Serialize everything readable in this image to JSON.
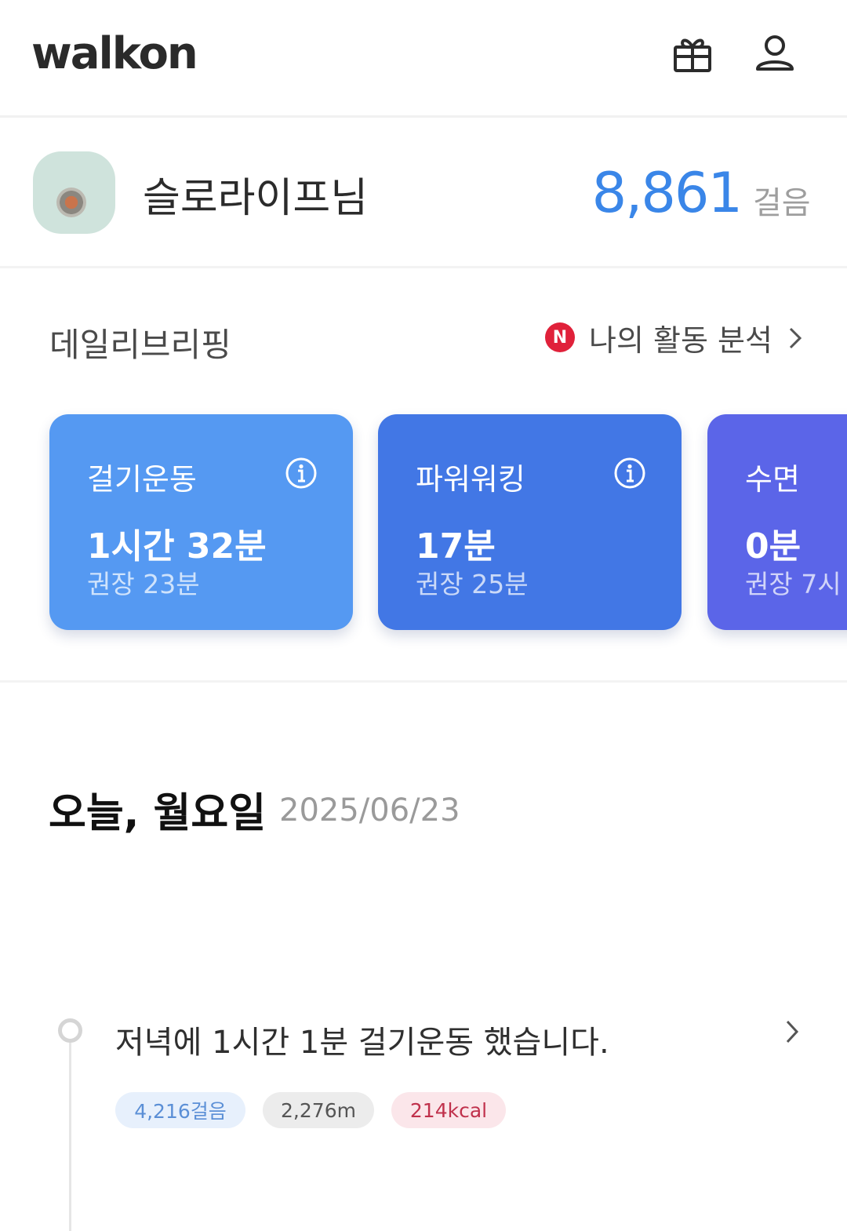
{
  "header": {
    "logo": "walkon",
    "gift_icon": "gift-icon",
    "profile_icon": "user-icon"
  },
  "profile": {
    "nickname": "슬로라이프님",
    "steps": "8,861",
    "steps_unit": "걸음",
    "accent_color": "#3a86e8"
  },
  "briefing": {
    "title": "데일리브리핑",
    "badge": "N",
    "analysis_label": "나의 활동 분석",
    "cards": [
      {
        "title": "걸기운동",
        "value": "1시간 32분",
        "recommend": "권장 23분",
        "color": "#5599f2"
      },
      {
        "title": "파워워킹",
        "value": "17분",
        "recommend": "권장 25분",
        "color": "#4277e5"
      },
      {
        "title": "수면",
        "value": "0분",
        "recommend": "권장 7시",
        "color": "#5b65e8"
      }
    ]
  },
  "today": {
    "title": "오늘, 월요일",
    "date": "2025/06/23"
  },
  "timeline": {
    "items": [
      {
        "text": "저녁에 1시간 1분 걸기운동 했습니다.",
        "steps": "4,216걸음",
        "distance": "2,276m",
        "calories": "214kcal"
      }
    ]
  }
}
